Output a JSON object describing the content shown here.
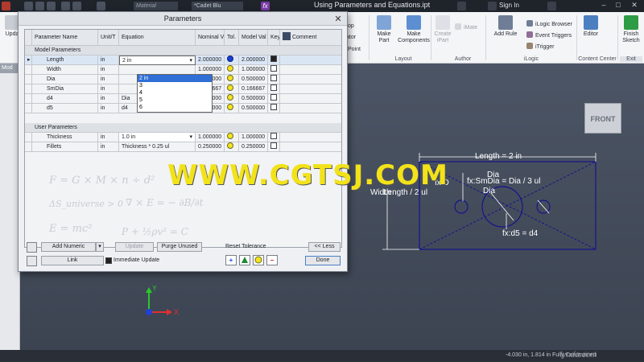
{
  "window": {
    "title": "Using Parameters and Equations.ipt",
    "material": "Material",
    "color": "*Cadet Blu",
    "sign_in": "Sign In"
  },
  "ribbon": {
    "update_label": "Upda",
    "groups": {
      "layout": "Layout",
      "author": "Author",
      "ilogic": "iLogic",
      "content_center": "Content Center",
      "exit": "Exit"
    },
    "buttons": {
      "make_part": "Make Part",
      "make_components": "Make Components",
      "create_ipart": "Create iPart",
      "imate": "iMate",
      "add_rule": "Add Rule",
      "ilogic_browser": "iLogic Browser",
      "event_triggers": "Event Triggers",
      "itrigger": "iTrigger",
      "editor": "Editor",
      "finish_sketch": "Finish Sketch",
      "stop": "top",
      "equator": "ator",
      "point": "Point"
    }
  },
  "left_panel": {
    "header": "Mod"
  },
  "dialog": {
    "title": "Parameters",
    "columns": [
      "Parameter Name",
      "Unit/T",
      "Equation",
      "Nominal V",
      "Tol.",
      "Model Val",
      "Key",
      "Comment"
    ],
    "model_group": "Model Parameters",
    "user_group": "User Parameters",
    "model_params": [
      {
        "name": "Length",
        "unit": "in",
        "equation": "2 in",
        "nominal": "2.000000",
        "tol": "blue",
        "model": "2.000000",
        "key": true
      },
      {
        "name": "Width",
        "unit": "in",
        "equation": "",
        "nominal": "1.000000",
        "tol": "yellow",
        "model": "1.000000",
        "key": false
      },
      {
        "name": "Dia",
        "unit": "in",
        "equation": "",
        "nominal": "0.500000",
        "tol": "yellow",
        "model": "0.500000",
        "key": false
      },
      {
        "name": "SmDia",
        "unit": "in",
        "equation": "",
        "nominal": "0.166667",
        "tol": "yellow",
        "model": "0.166667",
        "key": false
      },
      {
        "name": "d4",
        "unit": "in",
        "equation": "Dia",
        "nominal": "0.500000",
        "tol": "yellow",
        "model": "0.500000",
        "key": false
      },
      {
        "name": "d5",
        "unit": "in",
        "equation": "d4",
        "nominal": "0.500000",
        "tol": "yellow",
        "model": "0.500000",
        "key": false
      }
    ],
    "user_params": [
      {
        "name": "Thickness",
        "unit": "in",
        "equation": "1.0 in",
        "nominal": "1.000000",
        "tol": "yellow",
        "model": "1.000000",
        "key": false
      },
      {
        "name": "Fillets",
        "unit": "in",
        "equation": "Thickness * 0.25 ul",
        "nominal": "0.250000",
        "tol": "yellow",
        "model": "0.250000",
        "key": false
      }
    ],
    "dropdown_options": [
      "2 in",
      "3",
      "4",
      "5",
      "6"
    ],
    "buttons": {
      "add_numeric": "Add Numeric",
      "update": "Update",
      "purge_unused": "Purge Unused",
      "less": "<< Less",
      "link": "Link",
      "immediate_update": "Immediate Update",
      "done": "Done",
      "reset_tolerance": "Reset Tolerance"
    },
    "background_formulas": [
      "F = G × M × n ÷ d²",
      "∇ × E = − ∂B/∂t",
      "E = mc²",
      "P + ½ρv² = C",
      "ΔS_universe > 0"
    ]
  },
  "sketch": {
    "length_dim": "Length = 2 in",
    "smdia_dim": "fx:SmDia = Dia / 3 ul",
    "width_dim": "Width",
    "length_half": "Length / 2 ul",
    "d5_dim": "fx:d5 = d4",
    "d4_label": "fx:D",
    "dia_label": "Dia",
    "dia_label2": "Dia"
  },
  "viewcube": {
    "face": "FRONT"
  },
  "triad": {
    "x": "X",
    "y": "Y"
  },
  "status": {
    "coords": "-4.030 in, 1.814 in  Fully Constrained",
    "watermark": "lynda.com"
  },
  "overlay": {
    "watermark": "WWW.CGTSJ.COM"
  },
  "colors": {
    "ribbon_bg": "#f4f5f7",
    "canvas_top": "#4c5565",
    "sketch_line": "#14148a",
    "dim_text": "#ffffff",
    "watermark": "#f2e21a"
  }
}
